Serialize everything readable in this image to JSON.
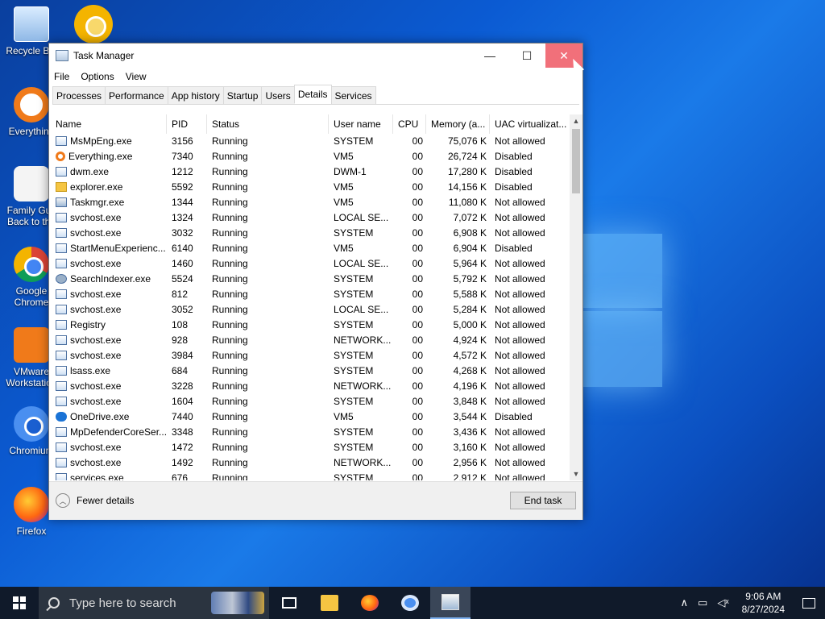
{
  "desktop": {
    "icons": [
      {
        "label": "Recycle Bin"
      },
      {
        "label": "Everything"
      },
      {
        "label": "Family Guy Back to the"
      },
      {
        "label": "Google Chrome"
      },
      {
        "label": "VMware Workstation"
      },
      {
        "label": "Chromium"
      },
      {
        "label": "Firefox"
      }
    ]
  },
  "window": {
    "title": "Task Manager",
    "controls": {
      "minimize": "—",
      "maximize": "☐",
      "close": "✕"
    },
    "menu": [
      "File",
      "Options",
      "View"
    ],
    "tabs": [
      "Processes",
      "Performance",
      "App history",
      "Startup",
      "Users",
      "Details",
      "Services"
    ],
    "active_tab": "Details",
    "columns": [
      "Name",
      "PID",
      "Status",
      "User name",
      "CPU",
      "Memory (a...",
      "UAC virtualizat..."
    ],
    "rows": [
      {
        "name": "MsMpEng.exe",
        "pid": "3156",
        "status": "Running",
        "user": "SYSTEM",
        "cpu": "00",
        "mem": "75,076 K",
        "uac": "Not allowed",
        "icon": "generic"
      },
      {
        "name": "Everything.exe",
        "pid": "7340",
        "status": "Running",
        "user": "VM5",
        "cpu": "00",
        "mem": "26,724 K",
        "uac": "Disabled",
        "icon": "everything"
      },
      {
        "name": "dwm.exe",
        "pid": "1212",
        "status": "Running",
        "user": "DWM-1",
        "cpu": "00",
        "mem": "17,280 K",
        "uac": "Disabled",
        "icon": "generic"
      },
      {
        "name": "explorer.exe",
        "pid": "5592",
        "status": "Running",
        "user": "VM5",
        "cpu": "00",
        "mem": "14,156 K",
        "uac": "Disabled",
        "icon": "folder"
      },
      {
        "name": "Taskmgr.exe",
        "pid": "1344",
        "status": "Running",
        "user": "VM5",
        "cpu": "00",
        "mem": "11,080 K",
        "uac": "Not allowed",
        "icon": "taskmgr"
      },
      {
        "name": "svchost.exe",
        "pid": "1324",
        "status": "Running",
        "user": "LOCAL SE...",
        "cpu": "00",
        "mem": "7,072 K",
        "uac": "Not allowed",
        "icon": "generic"
      },
      {
        "name": "svchost.exe",
        "pid": "3032",
        "status": "Running",
        "user": "SYSTEM",
        "cpu": "00",
        "mem": "6,908 K",
        "uac": "Not allowed",
        "icon": "generic"
      },
      {
        "name": "StartMenuExperienc...",
        "pid": "6140",
        "status": "Running",
        "user": "VM5",
        "cpu": "00",
        "mem": "6,904 K",
        "uac": "Disabled",
        "icon": "generic"
      },
      {
        "name": "svchost.exe",
        "pid": "1460",
        "status": "Running",
        "user": "LOCAL SE...",
        "cpu": "00",
        "mem": "5,964 K",
        "uac": "Not allowed",
        "icon": "generic"
      },
      {
        "name": "SearchIndexer.exe",
        "pid": "5524",
        "status": "Running",
        "user": "SYSTEM",
        "cpu": "00",
        "mem": "5,792 K",
        "uac": "Not allowed",
        "icon": "search"
      },
      {
        "name": "svchost.exe",
        "pid": "812",
        "status": "Running",
        "user": "SYSTEM",
        "cpu": "00",
        "mem": "5,588 K",
        "uac": "Not allowed",
        "icon": "generic"
      },
      {
        "name": "svchost.exe",
        "pid": "3052",
        "status": "Running",
        "user": "LOCAL SE...",
        "cpu": "00",
        "mem": "5,284 K",
        "uac": "Not allowed",
        "icon": "generic"
      },
      {
        "name": "Registry",
        "pid": "108",
        "status": "Running",
        "user": "SYSTEM",
        "cpu": "00",
        "mem": "5,000 K",
        "uac": "Not allowed",
        "icon": "generic"
      },
      {
        "name": "svchost.exe",
        "pid": "928",
        "status": "Running",
        "user": "NETWORK...",
        "cpu": "00",
        "mem": "4,924 K",
        "uac": "Not allowed",
        "icon": "generic"
      },
      {
        "name": "svchost.exe",
        "pid": "3984",
        "status": "Running",
        "user": "SYSTEM",
        "cpu": "00",
        "mem": "4,572 K",
        "uac": "Not allowed",
        "icon": "generic"
      },
      {
        "name": "lsass.exe",
        "pid": "684",
        "status": "Running",
        "user": "SYSTEM",
        "cpu": "00",
        "mem": "4,268 K",
        "uac": "Not allowed",
        "icon": "generic"
      },
      {
        "name": "svchost.exe",
        "pid": "3228",
        "status": "Running",
        "user": "NETWORK...",
        "cpu": "00",
        "mem": "4,196 K",
        "uac": "Not allowed",
        "icon": "generic"
      },
      {
        "name": "svchost.exe",
        "pid": "1604",
        "status": "Running",
        "user": "SYSTEM",
        "cpu": "00",
        "mem": "3,848 K",
        "uac": "Not allowed",
        "icon": "generic"
      },
      {
        "name": "OneDrive.exe",
        "pid": "7440",
        "status": "Running",
        "user": "VM5",
        "cpu": "00",
        "mem": "3,544 K",
        "uac": "Disabled",
        "icon": "cloud"
      },
      {
        "name": "MpDefenderCoreSer...",
        "pid": "3348",
        "status": "Running",
        "user": "SYSTEM",
        "cpu": "00",
        "mem": "3,436 K",
        "uac": "Not allowed",
        "icon": "generic"
      },
      {
        "name": "svchost.exe",
        "pid": "1472",
        "status": "Running",
        "user": "SYSTEM",
        "cpu": "00",
        "mem": "3,160 K",
        "uac": "Not allowed",
        "icon": "generic"
      },
      {
        "name": "svchost.exe",
        "pid": "1492",
        "status": "Running",
        "user": "NETWORK...",
        "cpu": "00",
        "mem": "2,956 K",
        "uac": "Not allowed",
        "icon": "generic"
      },
      {
        "name": "services.exe",
        "pid": "676",
        "status": "Running",
        "user": "SYSTEM",
        "cpu": "00",
        "mem": "2,912 K",
        "uac": "Not allowed",
        "icon": "generic"
      }
    ],
    "footer": {
      "fewer_details": "Fewer details",
      "end_task": "End task"
    }
  },
  "taskbar": {
    "search_placeholder": "Type here to search",
    "pinned": [
      "task-view-icon",
      "file-explorer-icon",
      "firefox-icon",
      "chromium-icon",
      "task-manager-icon"
    ],
    "clock_time": "9:06 AM",
    "clock_date": "8/27/2024"
  },
  "colors": {
    "close_hover": "#f1707a",
    "taskbar": "#101a2a",
    "desktop_blue": "#0b5bd3"
  }
}
